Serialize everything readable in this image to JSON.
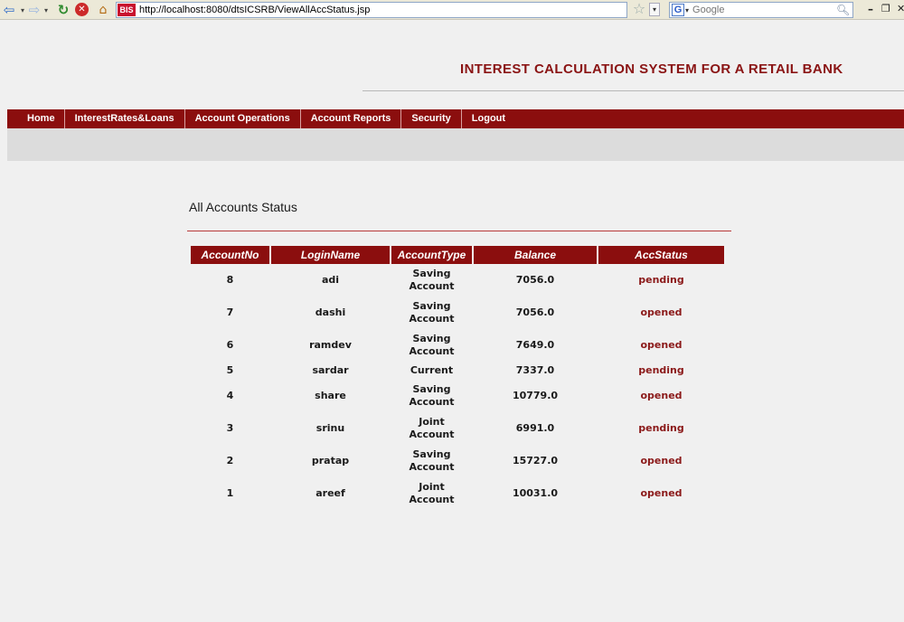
{
  "browser": {
    "url": "http://localhost:8080/dtsICSRB/ViewAllAccStatus.jsp",
    "site_badge": "BIS",
    "search_placeholder": "Google",
    "search_engine_icon": "G"
  },
  "header": {
    "title": "INTEREST CALCULATION SYSTEM FOR A RETAIL BANK"
  },
  "nav": {
    "items": [
      "Home",
      "InterestRates&Loans",
      "Account Operations",
      "Account Reports",
      "Security",
      "Logout"
    ]
  },
  "main": {
    "section_title": "All Accounts Status",
    "table": {
      "headers": [
        "AccountNo",
        "LoginName",
        "AccountType",
        "Balance",
        "AccStatus"
      ],
      "rows": [
        {
          "account_no": "8",
          "login": "adi",
          "type_line1": "Saving",
          "type_line2": "Account",
          "balance": "7056.0",
          "status": "pending"
        },
        {
          "account_no": "7",
          "login": "dashi",
          "type_line1": "Saving",
          "type_line2": "Account",
          "balance": "7056.0",
          "status": "opened"
        },
        {
          "account_no": "6",
          "login": "ramdev",
          "type_line1": "Saving",
          "type_line2": "Account",
          "balance": "7649.0",
          "status": "opened"
        },
        {
          "account_no": "5",
          "login": "sardar",
          "type_line1": "Current",
          "type_line2": "",
          "balance": "7337.0",
          "status": "pending"
        },
        {
          "account_no": "4",
          "login": "share",
          "type_line1": "Saving",
          "type_line2": "Account",
          "balance": "10779.0",
          "status": "opened"
        },
        {
          "account_no": "3",
          "login": "srinu",
          "type_line1": "Joint",
          "type_line2": "Account",
          "balance": "6991.0",
          "status": "pending"
        },
        {
          "account_no": "2",
          "login": "pratap",
          "type_line1": "Saving",
          "type_line2": "Account",
          "balance": "15727.0",
          "status": "opened"
        },
        {
          "account_no": "1",
          "login": "areef",
          "type_line1": "Joint",
          "type_line2": "Account",
          "balance": "10031.0",
          "status": "opened"
        }
      ]
    }
  },
  "colors": {
    "brand": "#8b0e0e",
    "status_text": "#8b1a1a"
  }
}
